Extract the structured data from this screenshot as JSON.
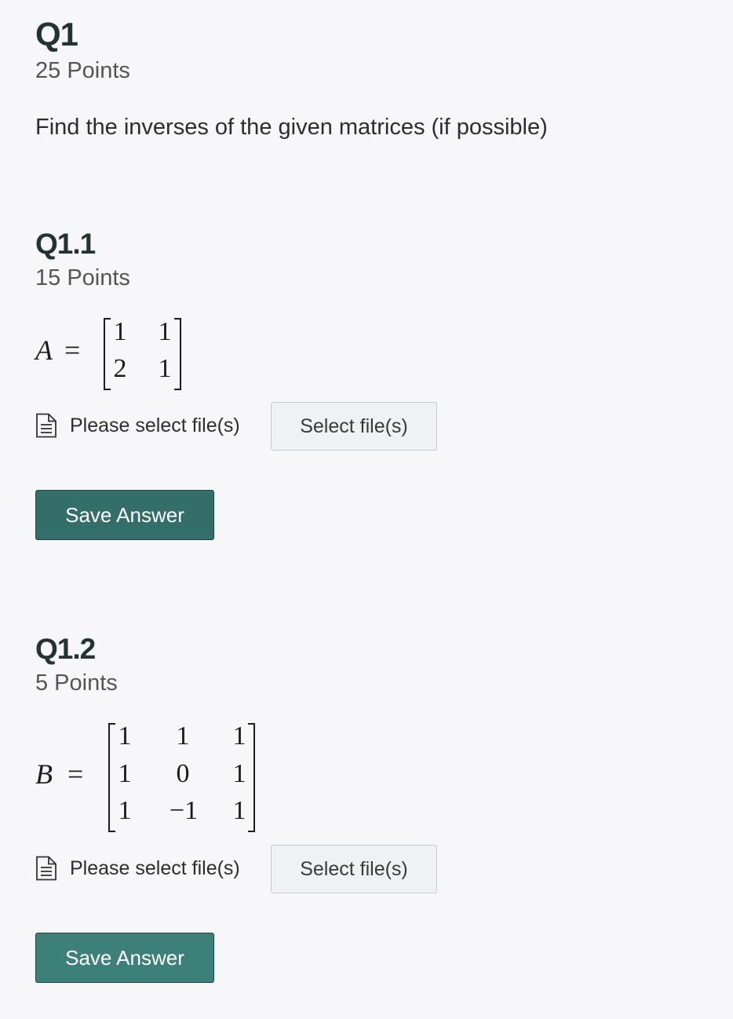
{
  "q1": {
    "title": "Q1",
    "points": "25 Points",
    "prompt": "Find the inverses of the given matrices (if possible)"
  },
  "q1_1": {
    "title": "Q1.1",
    "points": "15 Points",
    "matrix": {
      "variable": "A",
      "equals": "=",
      "rows": [
        [
          "1",
          "1"
        ],
        [
          "2",
          "1"
        ]
      ]
    },
    "file_label": "Please select file(s)",
    "select_button": "Select file(s)",
    "save_button": "Save Answer",
    "save_color": "#336e68"
  },
  "q1_2": {
    "title": "Q1.2",
    "points": "5 Points",
    "matrix": {
      "variable": "B",
      "equals": "=",
      "rows": [
        [
          "1",
          "1",
          "1"
        ],
        [
          "1",
          "0",
          "1"
        ],
        [
          "1",
          "−1",
          "1"
        ]
      ]
    },
    "file_label": "Please select file(s)",
    "select_button": "Select file(s)",
    "save_button": "Save Answer",
    "save_color": "#3d7f79"
  }
}
